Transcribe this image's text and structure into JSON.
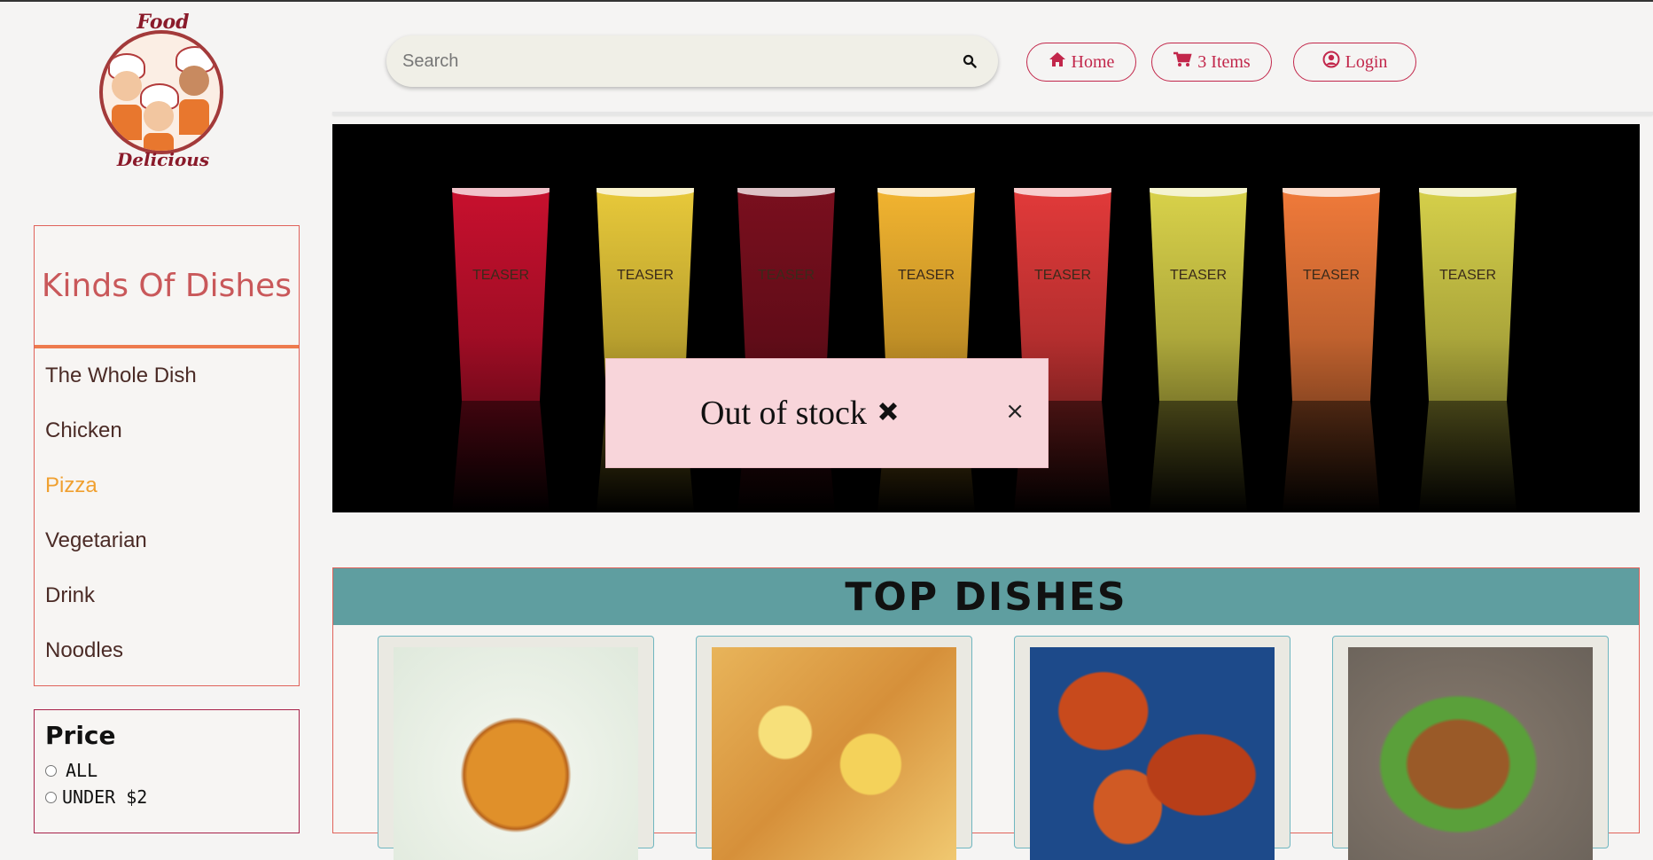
{
  "logo": {
    "top_text": "Food",
    "bottom_text": "Delicious"
  },
  "header": {
    "search_placeholder": "Search",
    "nav": [
      {
        "label": "Home",
        "icon": "home-icon"
      },
      {
        "label": "3 Items",
        "icon": "cart-icon"
      },
      {
        "label": "Login",
        "icon": "user-circle-icon"
      }
    ]
  },
  "sidebar": {
    "title": "Kinds Of Dishes",
    "items": [
      {
        "label": "The Whole Dish",
        "active": false
      },
      {
        "label": "Chicken",
        "active": false
      },
      {
        "label": "Pizza",
        "active": true
      },
      {
        "label": "Vegetarian",
        "active": false
      },
      {
        "label": "Drink",
        "active": false
      },
      {
        "label": "Noodles",
        "active": false
      }
    ],
    "price": {
      "title": "Price",
      "options": [
        {
          "label": "ALL"
        },
        {
          "label": "UNDER $2"
        }
      ]
    }
  },
  "banner": {
    "cup_brand": "TEASER",
    "cups": [
      "#c8102e",
      "#e8c93a",
      "#7a0f1e",
      "#f2b430",
      "#e23a3a",
      "#d9d24a",
      "#f07a3a",
      "#d6d04a"
    ]
  },
  "popup": {
    "message": "Out of stock",
    "close_label": "×"
  },
  "top_dishes": {
    "title": "TOP DISHES",
    "cards": [
      {
        "image": "fried-chicken-image"
      },
      {
        "image": "pizza-image"
      },
      {
        "image": "grilled-chicken-image"
      },
      {
        "image": "roast-chicken-image"
      }
    ]
  },
  "colors": {
    "accent": "#c2274b",
    "panel_border": "#e0625a",
    "header_teal": "#5f9ea0",
    "active_item": "#f0a030"
  }
}
